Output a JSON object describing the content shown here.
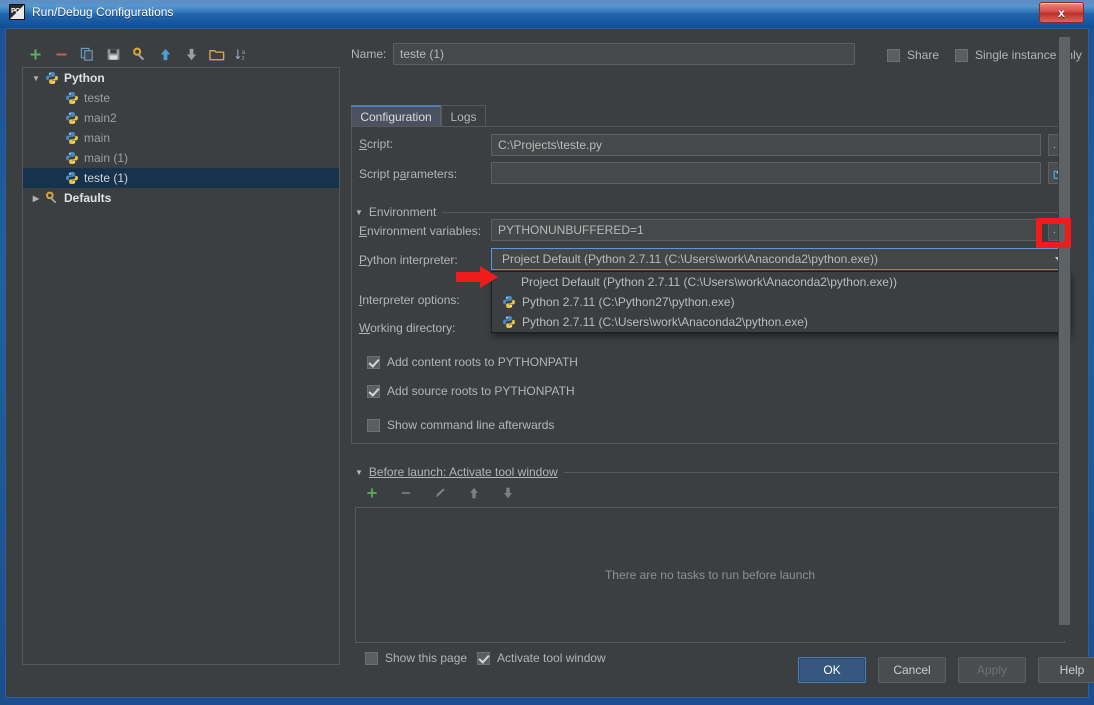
{
  "window": {
    "title": "Run/Debug Configurations",
    "app_icon": "pycharm-icon",
    "close_label": "x"
  },
  "tree_toolbar": {
    "buttons": [
      {
        "name": "add-configuration-button",
        "icon": "plus-icon",
        "label": "+"
      },
      {
        "name": "remove-configuration-button",
        "icon": "minus-icon",
        "label": "−"
      },
      {
        "name": "copy-configuration-button",
        "icon": "copy-icon",
        "label": ""
      },
      {
        "name": "save-configuration-button",
        "icon": "save-icon",
        "label": ""
      },
      {
        "name": "edit-defaults-button",
        "icon": "wrench-icon",
        "label": ""
      },
      {
        "name": "move-up-button",
        "icon": "arrow-up-icon",
        "label": ""
      },
      {
        "name": "move-down-button",
        "icon": "arrow-down-icon",
        "label": ""
      },
      {
        "name": "new-folder-button",
        "icon": "folder-icon",
        "label": ""
      },
      {
        "name": "sort-alphabetically-button",
        "icon": "sort-az-icon",
        "label": ""
      }
    ]
  },
  "tree": {
    "nodes": [
      {
        "label": "Python",
        "type": "group",
        "icon": "python-icon",
        "twisty": "▼",
        "selected": false
      },
      {
        "label": "teste",
        "type": "child",
        "icon": "python-icon",
        "twisty": "",
        "selected": false
      },
      {
        "label": "main2",
        "type": "child",
        "icon": "python-icon",
        "twisty": "",
        "selected": false
      },
      {
        "label": "main",
        "type": "child",
        "icon": "python-icon",
        "twisty": "",
        "selected": false
      },
      {
        "label": "main (1)",
        "type": "child",
        "icon": "python-icon",
        "twisty": "",
        "selected": false
      },
      {
        "label": "teste (1)",
        "type": "child",
        "icon": "python-icon",
        "twisty": "",
        "selected": true
      },
      {
        "label": "Defaults",
        "type": "group",
        "icon": "wrench-icon",
        "twisty": "▶",
        "selected": false
      }
    ]
  },
  "header": {
    "name_label": "Name:",
    "name_value": "teste (1)",
    "name_placeholder": "",
    "share_label": "Share",
    "share_checked": false,
    "single_instance_label": "Single instance only",
    "single_instance_checked": false
  },
  "tabs": [
    {
      "label": "Configuration",
      "active": true
    },
    {
      "label": "Logs",
      "active": false
    }
  ],
  "configuration": {
    "script_label": "Script:",
    "script_value": "C:\\Projects\\teste.py",
    "script_browse_label": "...",
    "script_params_label": "Script parameters:",
    "script_params_value": "",
    "script_params_macro_icon": "insert-macro-icon",
    "environment_section_label": "Environment",
    "env_vars_label": "Environment variables:",
    "env_vars_value": "PYTHONUNBUFFERED=1",
    "env_vars_browse_label": "...",
    "interpreter_label": "Python interpreter:",
    "interpreter_value": "Project Default (Python 2.7.11 (C:\\Users\\work\\Anaconda2\\python.exe))",
    "interpreter_dropdown_icon": "chevron-down-icon",
    "interpreter_options_label": "Interpreter options:",
    "working_directory_label": "Working directory:",
    "checkboxes": [
      {
        "label": "Add content roots to PYTHONPATH",
        "checked": true,
        "name": "add-content-roots-checkbox"
      },
      {
        "label": "Add source roots to PYTHONPATH",
        "checked": true,
        "name": "add-source-roots-checkbox"
      },
      {
        "label": "Show command line afterwards",
        "checked": false,
        "name": "show-command-line-checkbox"
      }
    ]
  },
  "interpreter_dropdown": {
    "open": true,
    "items": [
      {
        "label": "Project Default (Python 2.7.11 (C:\\Users\\work\\Anaconda2\\python.exe))",
        "icon": "",
        "highlighted": false
      },
      {
        "label": "Python 2.7.11 (C:\\Python27\\python.exe)",
        "icon": "python-icon",
        "highlighted": false
      },
      {
        "label": "Python 2.7.11 (C:\\Users\\work\\Anaconda2\\python.exe)",
        "icon": "python-icon",
        "highlighted": false
      }
    ]
  },
  "before_launch": {
    "section_label": "Before launch: Activate tool window",
    "toolbar": [
      {
        "name": "before-launch-add-button",
        "icon": "plus-icon"
      },
      {
        "name": "before-launch-remove-button",
        "icon": "minus-icon"
      },
      {
        "name": "before-launch-edit-button",
        "icon": "pencil-icon"
      },
      {
        "name": "before-launch-move-up-button",
        "icon": "arrow-up-icon"
      },
      {
        "name": "before-launch-move-down-button",
        "icon": "arrow-down-icon"
      }
    ],
    "empty_text": "There are no tasks to run before launch",
    "show_this_page_label": "Show this page",
    "show_this_page_checked": false,
    "activate_tool_window_label": "Activate tool window",
    "activate_tool_window_checked": true
  },
  "footer": {
    "ok_label": "OK",
    "cancel_label": "Cancel",
    "apply_label": "Apply",
    "help_label": "Help"
  },
  "annotations": {
    "highlight_color": "#f01c1c",
    "box_target": "interpreter-dropdown-arrow",
    "arrow_target": "interpreter-option-python27"
  },
  "colors": {
    "dialog_bg": "#3c3f41",
    "field_bg": "#45494a",
    "accent": "#365880",
    "selection": "#16324d",
    "titlebar": "#1f63ac"
  }
}
